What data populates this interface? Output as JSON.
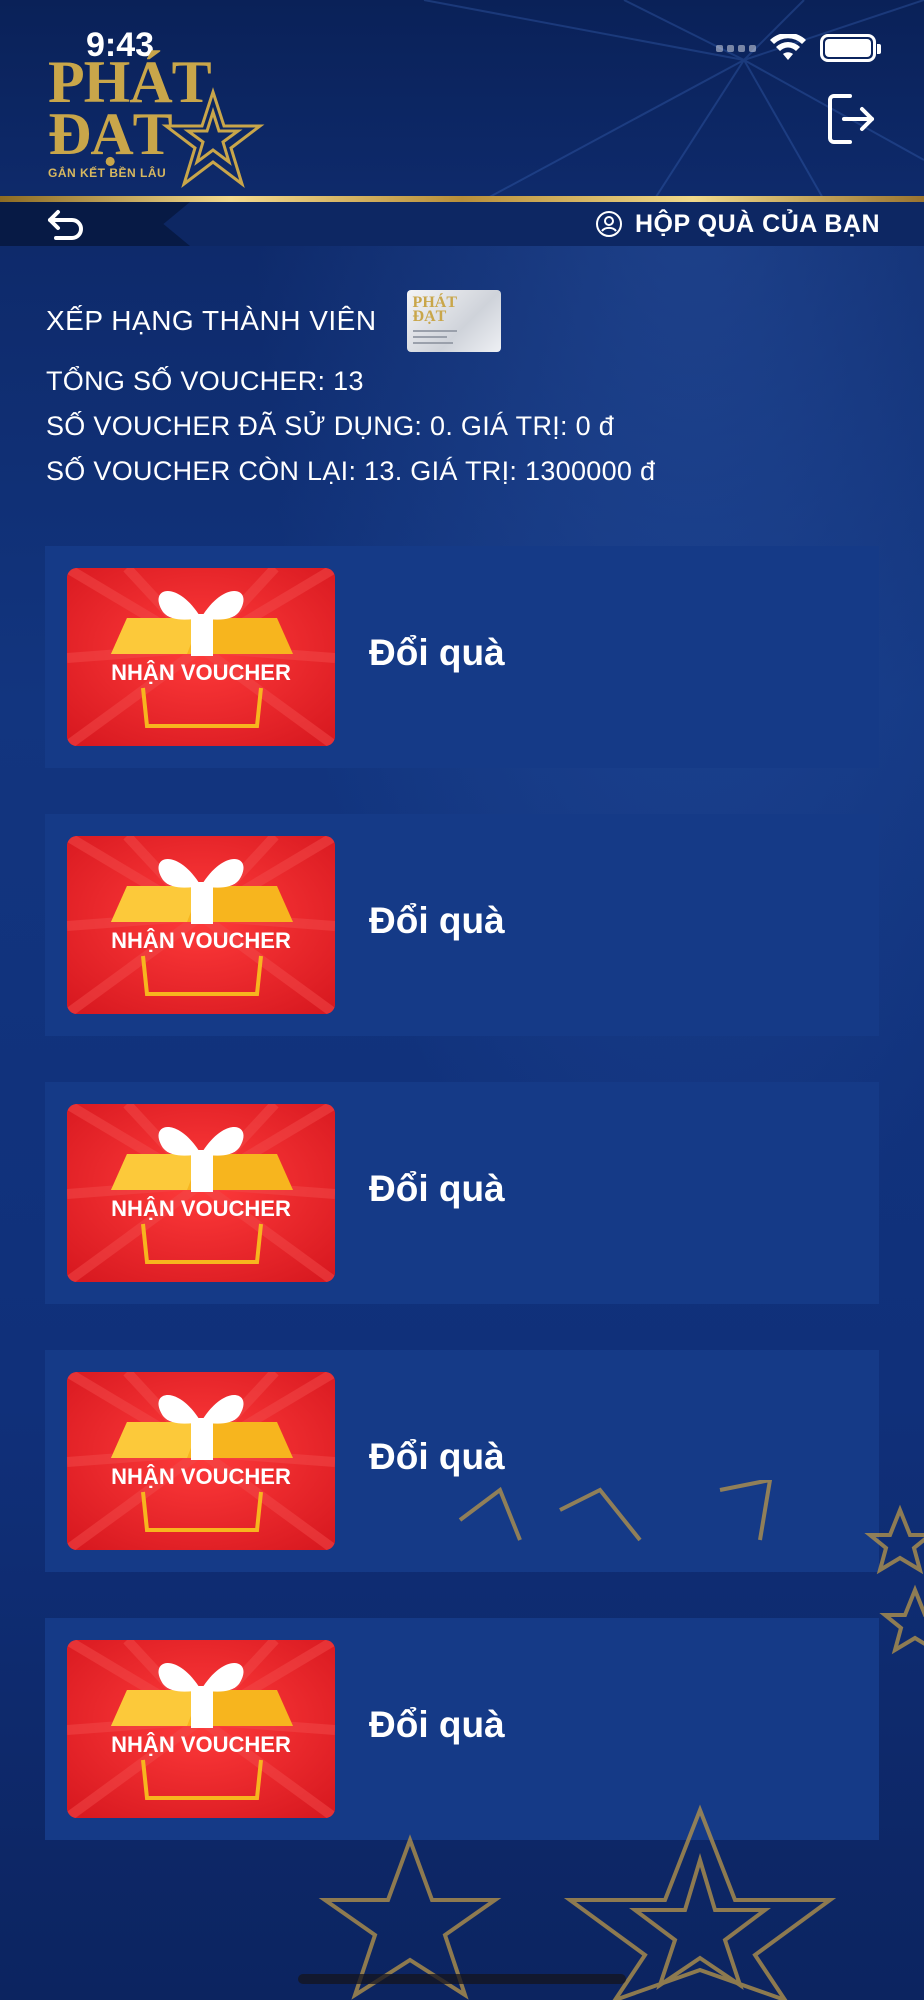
{
  "status_bar": {
    "time": "9:43"
  },
  "header": {
    "logo_title": "PHÁT ĐẠT",
    "logo_line1": "PHÁT",
    "logo_line2": "ĐẠT",
    "logo_tagline": "GẮN KẾT BỀN LÂU"
  },
  "nav": {
    "gift_box_label": "HỘP QUÀ CỦA BẠN"
  },
  "member": {
    "rank_label": "XẾP HẠNG THÀNH VIÊN",
    "total_vouchers": "TỔNG SỐ VOUCHER: 13",
    "used_vouchers": "SỐ VOUCHER ĐÃ SỬ DỤNG: 0. GIÁ TRỊ: 0 đ",
    "remaining_vouchers": "SỐ VOUCHER CÒN LẠI: 13. GIÁ TRỊ: 1300000 đ"
  },
  "vouchers": [
    {
      "image_text": "NHẬN VOUCHER",
      "action": "Đổi quà"
    },
    {
      "image_text": "NHẬN VOUCHER",
      "action": "Đổi quà"
    },
    {
      "image_text": "NHẬN VOUCHER",
      "action": "Đổi quà"
    },
    {
      "image_text": "NHẬN VOUCHER",
      "action": "Đổi quà"
    },
    {
      "image_text": "NHẬN VOUCHER",
      "action": "Đổi quà"
    }
  ],
  "colors": {
    "background": "#10307a",
    "card": "#153a87",
    "gold": "#c9a64a",
    "voucher_red": "#e3202a"
  },
  "icons": [
    "wifi-icon",
    "battery-icon",
    "exit-icon",
    "back-icon",
    "user-icon",
    "gift-icon"
  ]
}
